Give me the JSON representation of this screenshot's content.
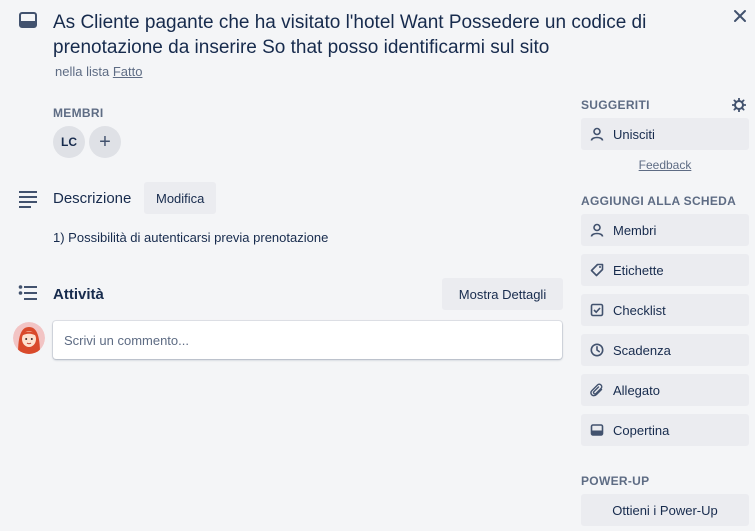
{
  "card": {
    "title": "As Cliente pagante che ha visitato l'hotel Want Possedere un codice di prenotazione da inserire So that posso identificarmi sul sito",
    "list_prefix": "nella lista",
    "list_name": "Fatto"
  },
  "members": {
    "label": "MEMBRI",
    "items": [
      {
        "initials": "LC"
      }
    ],
    "add_symbol": "+"
  },
  "description": {
    "title": "Descrizione",
    "edit_label": "Modifica",
    "text": "1) Possibilità di autenticarsi previa prenotazione"
  },
  "activity": {
    "title": "Attività",
    "details_label": "Mostra Dettagli",
    "comment_placeholder": "Scrivi un commento..."
  },
  "sidebar": {
    "suggested_label": "SUGGERITI",
    "join_label": "Unisciti",
    "feedback_label": "Feedback",
    "add_to_card_label": "AGGIUNGI ALLA SCHEDA",
    "actions": [
      {
        "label": "Membri",
        "icon": "person-icon"
      },
      {
        "label": "Etichette",
        "icon": "tag-icon"
      },
      {
        "label": "Checklist",
        "icon": "checkbox-icon"
      },
      {
        "label": "Scadenza",
        "icon": "clock-icon"
      },
      {
        "label": "Allegato",
        "icon": "paperclip-icon"
      },
      {
        "label": "Copertina",
        "icon": "cover-icon"
      }
    ],
    "powerup_label": "POWER-UP",
    "get_powerups_label": "Ottieni i Power-Up"
  },
  "colors": {
    "background": "#f4f5f7",
    "button_bg": "#ebecf0",
    "text": "#172b4d",
    "muted": "#5e6c84",
    "avatar_hair": "#d94a2b"
  }
}
